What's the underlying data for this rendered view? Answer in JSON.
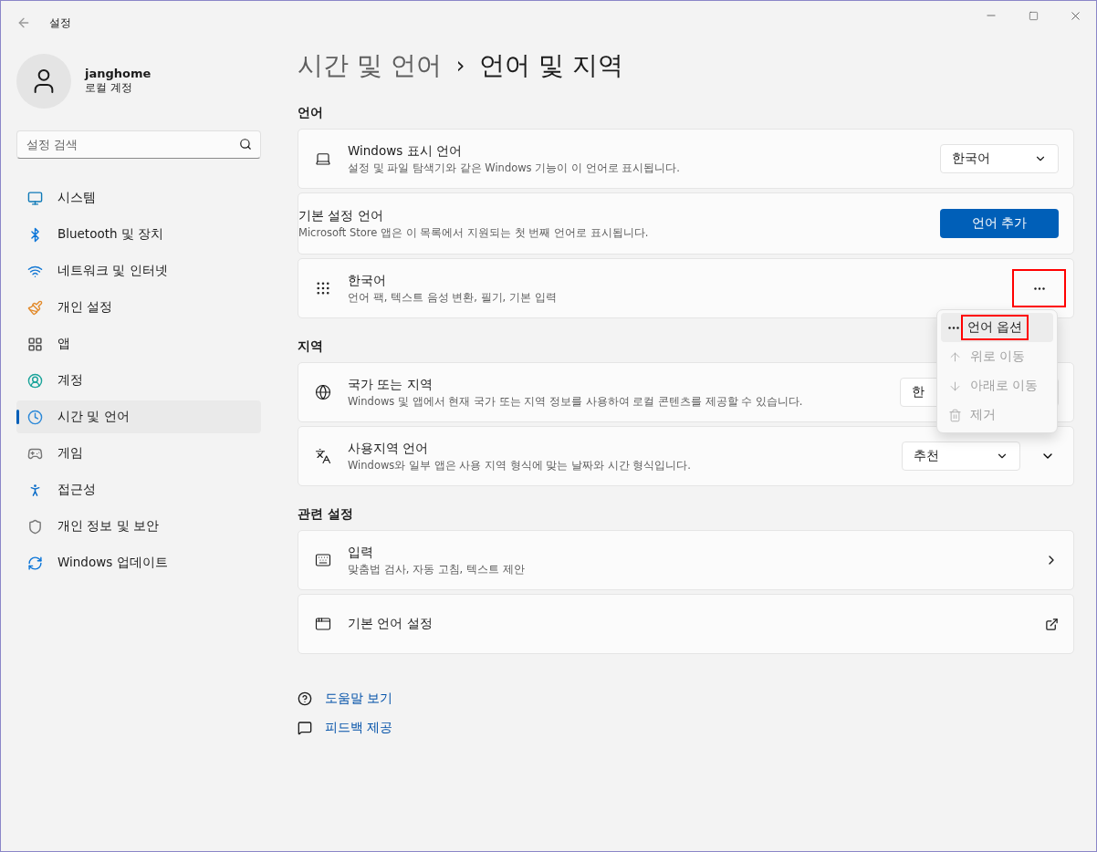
{
  "window": {
    "title": "설정"
  },
  "account": {
    "name": "janghome",
    "type": "로컬 계정"
  },
  "search": {
    "placeholder": "설정 검색"
  },
  "sidebar": {
    "items": [
      {
        "label": "시스템",
        "selected": false
      },
      {
        "label": "Bluetooth 및 장치",
        "selected": false
      },
      {
        "label": "네트워크 및 인터넷",
        "selected": false
      },
      {
        "label": "개인 설정",
        "selected": false
      },
      {
        "label": "앱",
        "selected": false
      },
      {
        "label": "계정",
        "selected": false
      },
      {
        "label": "시간 및 언어",
        "selected": true
      },
      {
        "label": "게임",
        "selected": false
      },
      {
        "label": "접근성",
        "selected": false
      },
      {
        "label": "개인 정보 및 보안",
        "selected": false
      },
      {
        "label": "Windows 업데이트",
        "selected": false
      }
    ]
  },
  "breadcrumb": {
    "parent": "시간 및 언어",
    "separator": "›",
    "current": "언어 및 지역"
  },
  "sections": [
    {
      "heading": "언어",
      "cards": [
        {
          "kind": "dropdown",
          "title": "Windows 표시 언어",
          "description": "설정 및 파일 탐색기와 같은 Windows 기능이 이 언어로 표시됩니다.",
          "value": "한국어"
        },
        {
          "kind": "button",
          "title": "기본 설정 언어",
          "description": "Microsoft Store 앱은 이 목록에서 지원되는 첫 번째 언어로 표시됩니다.",
          "button": "언어 추가"
        },
        {
          "kind": "language",
          "title": "한국어",
          "description": "언어 팩, 텍스트 음성 변환, 필기, 기본 입력",
          "highlighted": true
        }
      ]
    },
    {
      "heading": "지역",
      "cards": [
        {
          "kind": "dropdown",
          "title": "국가 또는 지역",
          "description": "Windows 및 앱에서 현재 국가 또는 지역 정보를 사용하여 로컬 콘텐츠를 제공할 수 있습니다.",
          "value": "한"
        },
        {
          "kind": "expand",
          "title": "사용지역 언어",
          "description": "Windows와 일부 앱은 사용 지역 형식에 맞는 날짜와 시간 형식입니다.",
          "value": "추천"
        }
      ]
    },
    {
      "heading": "관련 설정",
      "cards": [
        {
          "kind": "link",
          "title": "입력",
          "description": "맞춤법 검사, 자동 고침, 텍스트 제안"
        },
        {
          "kind": "external",
          "title": "기본 언어 설정"
        }
      ]
    }
  ],
  "context_menu": {
    "items": [
      {
        "label": "언어 옵션",
        "disabled": false,
        "selected": true,
        "highlighted": true
      },
      {
        "label": "위로 이동",
        "disabled": true,
        "selected": false,
        "highlighted": false
      },
      {
        "label": "아래로 이동",
        "disabled": true,
        "selected": false,
        "highlighted": false
      },
      {
        "label": "제거",
        "disabled": true,
        "selected": false,
        "highlighted": false
      }
    ]
  },
  "links": [
    "도움말 보기",
    "피드백 제공"
  ]
}
